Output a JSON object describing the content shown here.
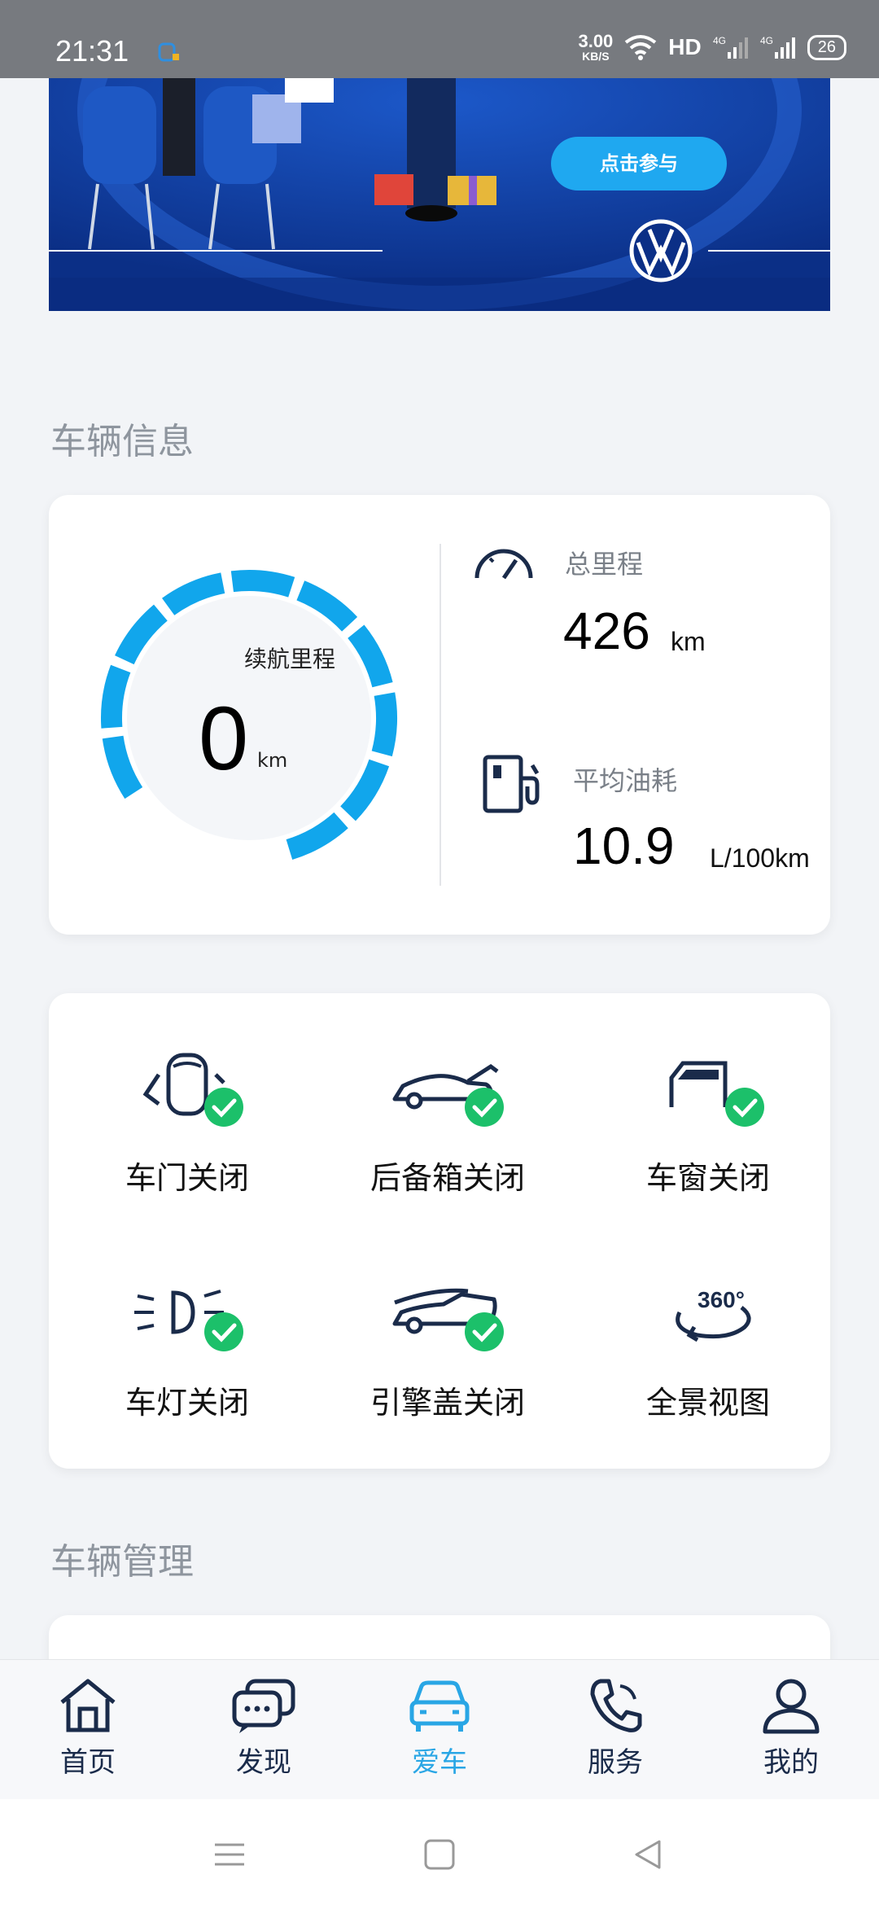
{
  "status_bar": {
    "time": "21:31",
    "net_speed": "3.00",
    "net_unit": "KB/S",
    "hd": "HD",
    "battery": "26"
  },
  "banner": {
    "button_label": "点击参与"
  },
  "vehicle_info": {
    "section_title": "车辆信息",
    "range_label": "续航里程",
    "range_value": "0",
    "range_unit": "km",
    "odometer_label": "总里程",
    "odometer_value": "426",
    "odometer_unit": "km",
    "fuel_label": "平均油耗",
    "fuel_value": "10.9",
    "fuel_unit": "L/100km"
  },
  "vehicle_status": {
    "items": [
      {
        "label": "车门关闭",
        "icon": "car-door-icon"
      },
      {
        "label": "后备箱关闭",
        "icon": "trunk-icon"
      },
      {
        "label": "车窗关闭",
        "icon": "car-window-icon"
      },
      {
        "label": "车灯关闭",
        "icon": "headlight-icon"
      },
      {
        "label": "引擎盖关闭",
        "icon": "hood-icon"
      },
      {
        "label": "全景视图",
        "icon": "360-view-icon"
      }
    ]
  },
  "vehicle_management": {
    "section_title": "车辆管理"
  },
  "bottom_nav": {
    "items": [
      {
        "label": "首页",
        "icon": "home-icon"
      },
      {
        "label": "发现",
        "icon": "discover-icon"
      },
      {
        "label": "爱车",
        "icon": "car-icon"
      },
      {
        "label": "服务",
        "icon": "phone-icon"
      },
      {
        "label": "我的",
        "icon": "profile-icon"
      }
    ],
    "active_index": 2
  },
  "colors": {
    "accent": "#29a6e5",
    "gauge": "#11a6ec",
    "check": "#1cc06a",
    "banner": "#0d3a9a",
    "navy": "#1a2b4a"
  }
}
